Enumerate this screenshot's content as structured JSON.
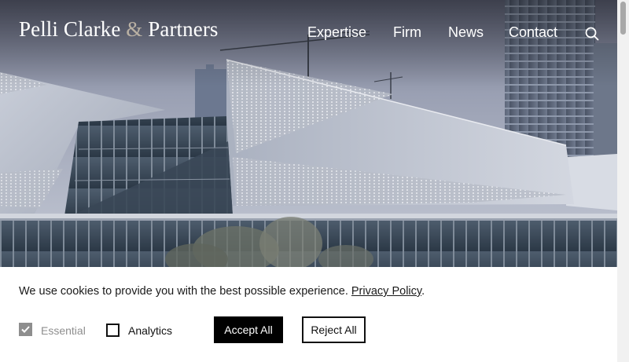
{
  "header": {
    "logo": {
      "part1": "Pelli Clarke",
      "amp": "&",
      "part2": "Partners"
    },
    "nav": [
      {
        "id": "expertise",
        "label": "Expertise"
      },
      {
        "id": "firm",
        "label": "Firm"
      },
      {
        "id": "news",
        "label": "News"
      },
      {
        "id": "contact",
        "label": "Contact"
      }
    ],
    "search_icon": "search-icon"
  },
  "hero": {
    "image": "building-photo",
    "description_icon": "hero-image"
  },
  "cookie_banner": {
    "message": "We use cookies to provide you with the best possible experience.",
    "policy_link": "Privacy Policy",
    "period": ".",
    "options": [
      {
        "id": "essential",
        "label": "Essential",
        "checked": true,
        "disabled": true
      },
      {
        "id": "analytics",
        "label": "Analytics",
        "checked": false,
        "disabled": false
      }
    ],
    "accept_label": "Accept All",
    "reject_label": "Reject All"
  },
  "colors": {
    "accent_amp": "#b9b0a3",
    "button_dark": "#000000",
    "disabled_gray": "#8e8e8e"
  }
}
